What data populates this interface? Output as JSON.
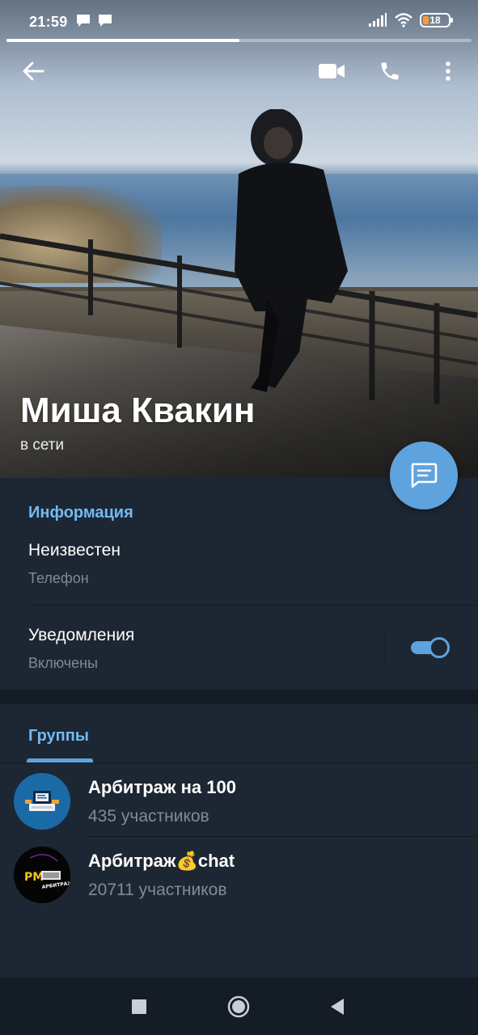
{
  "status_bar": {
    "time": "21:59",
    "battery_level": "18",
    "icons": [
      "message-notification-icon",
      "message-notification-icon",
      "signal-icon",
      "wifi-icon",
      "battery-icon"
    ]
  },
  "story_progress": {
    "fraction": 0.5
  },
  "toolbar": {
    "icons": [
      "back-arrow-icon",
      "video-call-icon",
      "phone-call-icon",
      "more-vertical-icon"
    ]
  },
  "profile": {
    "name": "Миша Квакин",
    "status": "в сети"
  },
  "info_section": {
    "title": "Информация",
    "phone_value": "Неизвестен",
    "phone_label": "Телефон",
    "notifications_value": "Уведомления",
    "notifications_label": "Включены",
    "notifications_enabled": true
  },
  "groups_section": {
    "tab_label": "Группы",
    "items": [
      {
        "name": "Арбитраж на 100",
        "members": "435 участников",
        "avatar_icon": "computer-icon"
      },
      {
        "name": "Арбитраж💰chat",
        "members": "20711 участников",
        "avatar_logo_text": "PM АРБИТРАЖ ЧАТ"
      }
    ]
  },
  "colors": {
    "accent": "#5fa3de",
    "section_title": "#71baf2",
    "background": "#1d2733",
    "secondary_text": "#7d8b99"
  }
}
